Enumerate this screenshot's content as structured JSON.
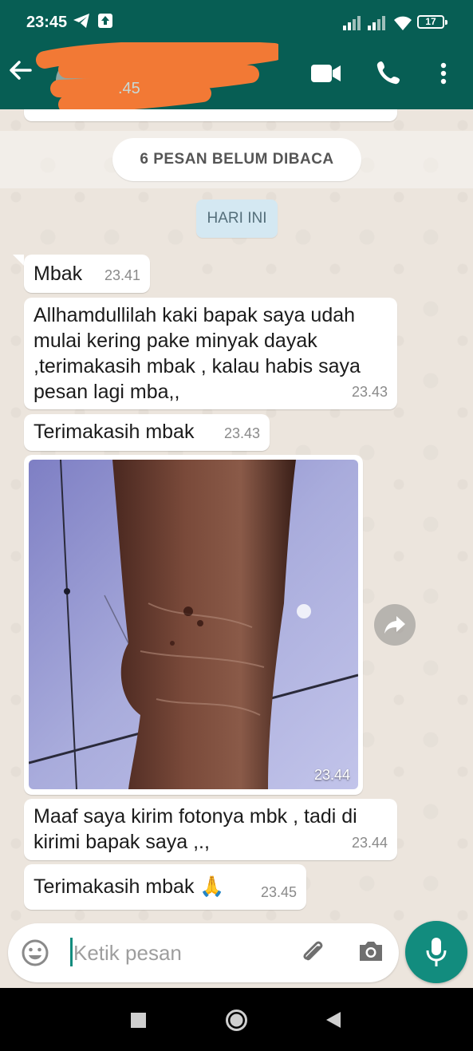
{
  "status_bar": {
    "time": "23:45",
    "battery": "17",
    "icons": [
      "telegram-icon",
      "upload-icon",
      "signal-icon",
      "signal-icon",
      "wifi-icon",
      "battery-icon"
    ]
  },
  "header": {
    "contact_subtitle": ".45",
    "icons": [
      "back-arrow-icon",
      "video-call-icon",
      "phone-call-icon",
      "more-options-icon"
    ]
  },
  "chat": {
    "unread_banner": "6 PESAN BELUM DIBACA",
    "day_label": "HARI INI",
    "messages": [
      {
        "text": "Mbak",
        "time": "23.41"
      },
      {
        "text": "Allhamdullilah kaki bapak saya udah mulai kering pake minyak dayak ,terimakasih mbak , kalau habis saya pesan lagi mba,,",
        "time": "23.43"
      },
      {
        "text": "Terimakasih mbak",
        "time": "23.43"
      },
      {
        "type": "image",
        "time": "23.44"
      },
      {
        "text": "Maaf saya kirim fotonya mbk , tadi di kirimi bapak saya ,.,",
        "time": "23.44"
      },
      {
        "text": "Terimakasih mbak 🙏",
        "time": "23.45"
      }
    ]
  },
  "input": {
    "placeholder": "Ketik pesan"
  },
  "colors": {
    "header": "#075e54",
    "accent": "#128c7e",
    "chat_bg": "#ece5dd"
  }
}
